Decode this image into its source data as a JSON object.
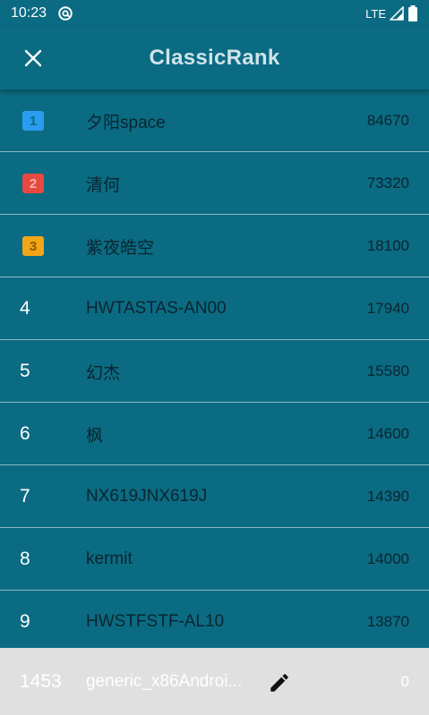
{
  "status_bar": {
    "time": "10:23",
    "network": "LTE",
    "app_icon": "at-sync-icon",
    "signal_icon": "signal-icon",
    "battery_icon": "battery-icon"
  },
  "app_bar": {
    "title": "ClassicRank",
    "close_icon": "close-icon"
  },
  "leaderboard": {
    "rows": [
      {
        "rank": "1",
        "name": "夕阳space",
        "score": "84670",
        "badge": true
      },
      {
        "rank": "2",
        "name": "清何",
        "score": "73320",
        "badge": true
      },
      {
        "rank": "3",
        "name": "紫夜皓空",
        "score": "18100",
        "badge": true
      },
      {
        "rank": "4",
        "name": "HWTASTAS-AN00",
        "score": "17940",
        "badge": false
      },
      {
        "rank": "5",
        "name": "幻杰",
        "score": "15580",
        "badge": false
      },
      {
        "rank": "6",
        "name": "枫",
        "score": "14600",
        "badge": false
      },
      {
        "rank": "7",
        "name": "NX619JNX619J",
        "score": "14390",
        "badge": false
      },
      {
        "rank": "8",
        "name": "kermit",
        "score": "14000",
        "badge": false
      },
      {
        "rank": "9",
        "name": "HWSTFSTF-AL10",
        "score": "13870",
        "badge": false
      }
    ]
  },
  "badge_colors": {
    "gold": "#f2a516",
    "silver": "#e8483f",
    "bronze": "#2b9cf0"
  },
  "current_user": {
    "rank": "1453",
    "name": "generic_x86Androi...",
    "score": "0",
    "edit_icon": "pencil-icon"
  }
}
